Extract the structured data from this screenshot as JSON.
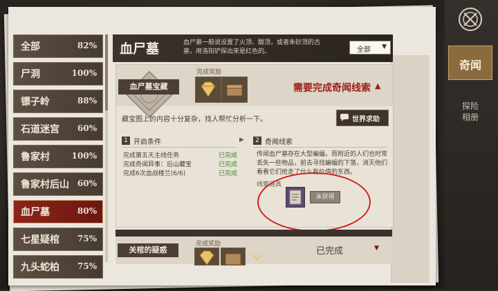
{
  "categories": [
    {
      "name": "全部",
      "percent": "82%"
    },
    {
      "name": "尸洞",
      "percent": "100%"
    },
    {
      "name": "镖子岭",
      "percent": "88%"
    },
    {
      "name": "石道迷宫",
      "percent": "60%"
    },
    {
      "name": "鲁家村",
      "percent": "100%"
    },
    {
      "name": "鲁家村后山",
      "percent": "60%"
    },
    {
      "name": "血尸墓",
      "percent": "80%",
      "active": true
    },
    {
      "name": "七星疑棺",
      "percent": "75%"
    },
    {
      "name": "九头蛇柏",
      "percent": "75%"
    }
  ],
  "header": {
    "title": "血尸墓",
    "description": "血尸墓一般说设置了火顶、酸顶，或者朱砂顶的古墓，用洛阳铲探出来是红色的。",
    "filter_value": "全部"
  },
  "card1": {
    "medal_label": "血尸墓宝藏",
    "reward_title": "完成奖励",
    "status": "需要完成奇闻线索",
    "description": "藏宝图上的内容十分复杂，找人帮忙分析一下。",
    "help_button": "世界求助",
    "section1": {
      "num": "1",
      "label": "开启条件"
    },
    "conditions": [
      {
        "text": "完成第五天主线任务",
        "status": "已完成"
      },
      {
        "text": "完成奇闻异事：后山藏宝",
        "status": "已完成"
      },
      {
        "text": "完成6次血战楼兰(6/6)",
        "status": "已完成"
      }
    ],
    "section2": {
      "num": "2",
      "label": "奇闻线索"
    },
    "story": "传闻血尸墓存在大型蝙蝠，而附近的人们也时常丢失一些物品，前去寻找蝙蝠的下落，消灭他们看看它们抢走了什么有价值的东西。",
    "clue_label": "线索道具",
    "clue_button": "未获得"
  },
  "card2": {
    "medal_label": "关棺的疑惑",
    "reward_title": "完成奖励",
    "status": "已完成"
  },
  "right_rail": {
    "tab_active": "奇闻",
    "tab_other": "探险\n相册"
  },
  "colors": {
    "active_red": "#8e241c",
    "accent_gold": "#caa56a",
    "done_green": "#3f8a2a",
    "annotation_red": "#d11f1f"
  }
}
